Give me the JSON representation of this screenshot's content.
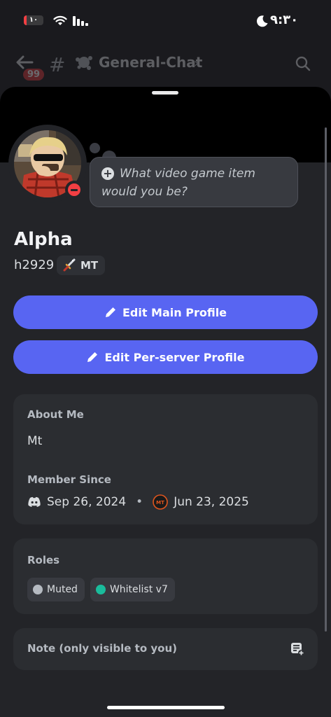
{
  "status_bar": {
    "time": "٩:٣٠",
    "battery_level": "١٠",
    "battery_fraction": 0.15
  },
  "header": {
    "unread_badge": "99",
    "channel_name": "General-Chat"
  },
  "profile": {
    "custom_status": "What video game item would you be?",
    "display_name": "Alpha",
    "username": "h2929",
    "server_tag": "MT",
    "status": "do-not-disturb"
  },
  "buttons": {
    "edit_main": "Edit Main Profile",
    "edit_per_server": "Edit Per-server Profile"
  },
  "about": {
    "label": "About Me",
    "text": "Mt",
    "member_since_label": "Member Since",
    "discord_since": "Sep 26, 2024",
    "separator": "•",
    "server_since": "Jun 23, 2025",
    "server_icon_text": "MT"
  },
  "roles": {
    "label": "Roles",
    "items": [
      {
        "name": "Muted",
        "color": "#b5bac1"
      },
      {
        "name": "Whitelist v7",
        "color": "#1abc9c"
      }
    ]
  },
  "note": {
    "label": "Note (only visible to you)"
  },
  "colors": {
    "accent": "#5865f2",
    "dnd": "#f23f43",
    "background": "#232428",
    "card": "#2b2d31"
  }
}
